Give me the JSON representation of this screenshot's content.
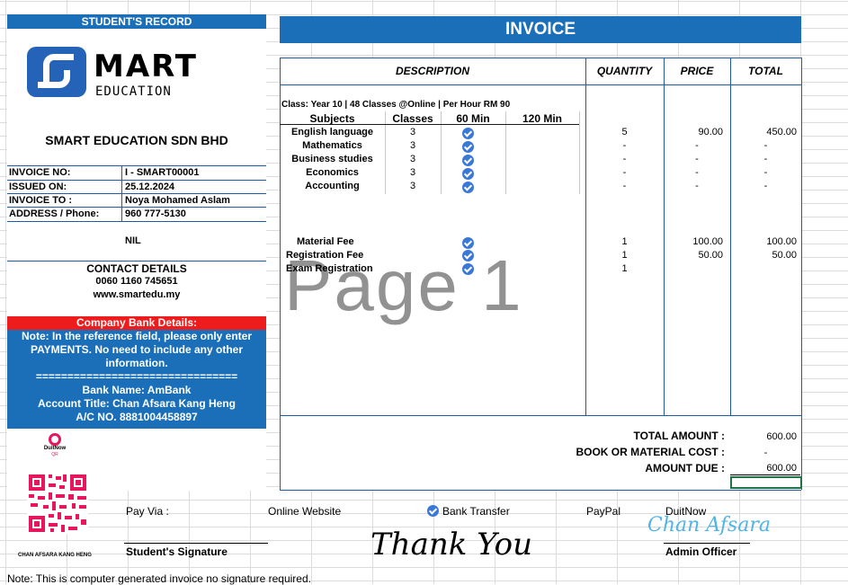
{
  "left": {
    "record_header": "STUDENT'S RECORD",
    "logo_main": "MART",
    "logo_sub": "EDUCATION",
    "company": "SMART EDUCATION SDN BHD",
    "invoice_no_label": "INVOICE NO:",
    "invoice_no": "I - SMART00001",
    "issued_label": "ISSUED ON:",
    "issued": "25.12.2024",
    "to_label": "INVOICE TO :",
    "to": "Noya Mohamed Aslam",
    "address_label": "ADDRESS / Phone:",
    "address": "960 777-5130",
    "nil": "NIL",
    "contact_title": "CONTACT DETAILS",
    "contact_phone": "0060 1160 745651",
    "contact_web": "www.smartedu.my"
  },
  "bank": {
    "header": "Company Bank Details:",
    "note": "Note: In the reference field, please only enter PAYMENTS. No need to include any other information.",
    "divider": "================================",
    "name": "Bank Name: AmBank",
    "title": "Account Title: Chan Afsara Kang Heng",
    "ac": "A/C NO. 8881004458897"
  },
  "qr": {
    "duitnow_label": "DuitNow",
    "duitnow_sub": "QR",
    "name": "CHAN AFSARA KANG HENG"
  },
  "invoice": {
    "title": "INVOICE",
    "cols": {
      "description": "DESCRIPTION",
      "quantity": "QUANTITY",
      "price": "PRICE",
      "total": "TOTAL"
    },
    "class_info": "Class: Year 10 |  48 Classes @Online | Per Hour RM 90",
    "sub_cols": {
      "subjects": "Subjects",
      "classes": "Classes",
      "min60": "60 Min",
      "min120": "120 Min"
    },
    "subjects": [
      {
        "name": "English language",
        "classes": "3",
        "qty": "5",
        "price": "90.00",
        "total": "450.00"
      },
      {
        "name": "Mathematics",
        "classes": "3",
        "qty": "-",
        "price": "-",
        "total": "-"
      },
      {
        "name": "Business studies",
        "classes": "3",
        "qty": "-",
        "price": "-",
        "total": "-"
      },
      {
        "name": "Economics",
        "classes": "3",
        "qty": "-",
        "price": "-",
        "total": "-"
      },
      {
        "name": "Accounting",
        "classes": "3",
        "qty": "-",
        "price": "-",
        "total": "-"
      }
    ],
    "fees": [
      {
        "name": "Material Fee",
        "qty": "1",
        "price": "100.00",
        "total": "100.00"
      },
      {
        "name": "Registration Fee",
        "qty": "1",
        "price": "50.00",
        "total": "50.00"
      },
      {
        "name": "Exam Registration",
        "qty": "1"
      }
    ],
    "watermark": "Page 1"
  },
  "totals": {
    "total_label": "TOTAL AMOUNT :",
    "total": "600.00",
    "book_label": "BOOK OR MATERIAL COST :",
    "book": "-",
    "due_label": "AMOUNT DUE :",
    "due": "600.00"
  },
  "payment": {
    "label": "Pay Via :",
    "online": "Online Website",
    "bank": "Bank Transfer",
    "paypal": "PayPal",
    "duitnow": "DuitNow"
  },
  "signatures": {
    "student": "Student's Signature",
    "thanks": "Thank You",
    "admin_sig": "Chan Afsara",
    "admin": "Admin Officer"
  },
  "footer": {
    "note": "Note: This is computer generated invoice no signature required."
  },
  "colors": {
    "accent_blue": "#1a6fb8",
    "bank_header_red": "#ee1c1c",
    "qr_pink": "#e8175d",
    "check_blue": "#3a78d8"
  }
}
